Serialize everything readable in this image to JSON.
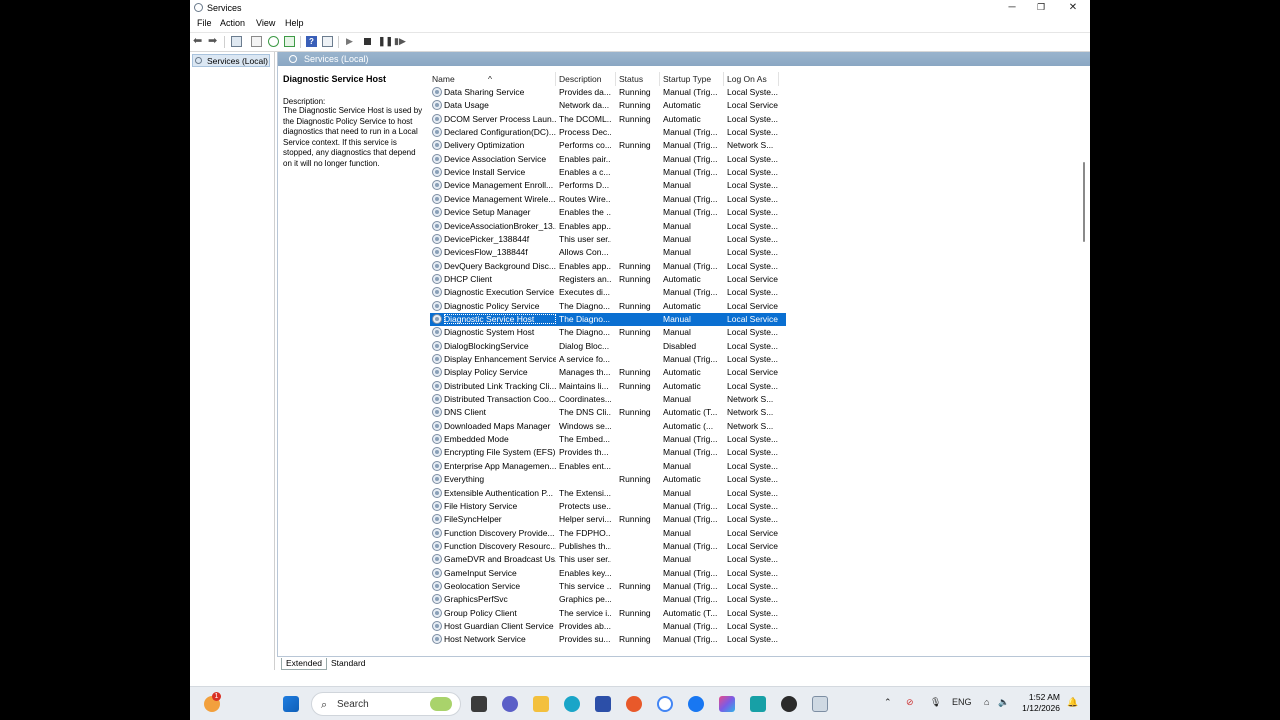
{
  "window": {
    "title": "Services",
    "minimize": "─",
    "maximize": "❐",
    "close": "✕"
  },
  "menu": [
    "File",
    "Action",
    "View",
    "Help"
  ],
  "tree": {
    "item": "Services (Local)"
  },
  "pane": {
    "header": "Services (Local)"
  },
  "details": {
    "service_title": "Diagnostic Service Host",
    "description_label": "Description:",
    "description": "The Diagnostic Service Host is used by the Diagnostic Policy Service to host diagnostics that need to run in a Local Service context.  If this service is stopped, any diagnostics that depend on it will no longer function."
  },
  "columns": [
    "Name",
    "Description",
    "Status",
    "Startup Type",
    "Log On As"
  ],
  "services": [
    [
      "Data Sharing Service",
      "Provides da...",
      "Running",
      "Manual (Trig...",
      "Local Syste..."
    ],
    [
      "Data Usage",
      "Network da...",
      "Running",
      "Automatic",
      "Local Service"
    ],
    [
      "DCOM Server Process Laun...",
      "The DCOML...",
      "Running",
      "Automatic",
      "Local Syste..."
    ],
    [
      "Declared Configuration(DC)...",
      "Process Dec...",
      "",
      "Manual (Trig...",
      "Local Syste..."
    ],
    [
      "Delivery Optimization",
      "Performs co...",
      "Running",
      "Manual (Trig...",
      "Network S..."
    ],
    [
      "Device Association Service",
      "Enables pair...",
      "",
      "Manual (Trig...",
      "Local Syste..."
    ],
    [
      "Device Install Service",
      "Enables a c...",
      "",
      "Manual (Trig...",
      "Local Syste..."
    ],
    [
      "Device Management Enroll...",
      "Performs D...",
      "",
      "Manual",
      "Local Syste..."
    ],
    [
      "Device Management Wirele...",
      "Routes Wire...",
      "",
      "Manual (Trig...",
      "Local Syste..."
    ],
    [
      "Device Setup Manager",
      "Enables the ...",
      "",
      "Manual (Trig...",
      "Local Syste..."
    ],
    [
      "DeviceAssociationBroker_13...",
      "Enables app...",
      "",
      "Manual",
      "Local Syste..."
    ],
    [
      "DevicePicker_138844f",
      "This user ser...",
      "",
      "Manual",
      "Local Syste..."
    ],
    [
      "DevicesFlow_138844f",
      "Allows Con...",
      "",
      "Manual",
      "Local Syste..."
    ],
    [
      "DevQuery Background Disc...",
      "Enables app...",
      "Running",
      "Manual (Trig...",
      "Local Syste..."
    ],
    [
      "DHCP Client",
      "Registers an...",
      "Running",
      "Automatic",
      "Local Service"
    ],
    [
      "Diagnostic Execution Service",
      "Executes di...",
      "",
      "Manual (Trig...",
      "Local Syste..."
    ],
    [
      "Diagnostic Policy Service",
      "The Diagno...",
      "Running",
      "Automatic",
      "Local Service"
    ],
    [
      "Diagnostic Service Host",
      "The Diagno...",
      "",
      "Manual",
      "Local Service"
    ],
    [
      "Diagnostic System Host",
      "The Diagno...",
      "Running",
      "Manual",
      "Local Syste..."
    ],
    [
      "DialogBlockingService",
      "Dialog Bloc...",
      "",
      "Disabled",
      "Local Syste..."
    ],
    [
      "Display Enhancement Service",
      "A service fo...",
      "",
      "Manual (Trig...",
      "Local Syste..."
    ],
    [
      "Display Policy Service",
      "Manages th...",
      "Running",
      "Automatic",
      "Local Service"
    ],
    [
      "Distributed Link Tracking Cli...",
      "Maintains li...",
      "Running",
      "Automatic",
      "Local Syste..."
    ],
    [
      "Distributed Transaction Coo...",
      "Coordinates...",
      "",
      "Manual",
      "Network S..."
    ],
    [
      "DNS Client",
      "The DNS Cli...",
      "Running",
      "Automatic (T...",
      "Network S..."
    ],
    [
      "Downloaded Maps Manager",
      "Windows se...",
      "",
      "Automatic (...",
      "Network S..."
    ],
    [
      "Embedded Mode",
      "The Embed...",
      "",
      "Manual (Trig...",
      "Local Syste..."
    ],
    [
      "Encrypting File System (EFS)",
      "Provides th...",
      "",
      "Manual (Trig...",
      "Local Syste..."
    ],
    [
      "Enterprise App Managemen...",
      "Enables ent...",
      "",
      "Manual",
      "Local Syste..."
    ],
    [
      "Everything",
      "",
      "Running",
      "Automatic",
      "Local Syste..."
    ],
    [
      "Extensible Authentication P...",
      "The Extensi...",
      "",
      "Manual",
      "Local Syste..."
    ],
    [
      "File History Service",
      "Protects use...",
      "",
      "Manual (Trig...",
      "Local Syste..."
    ],
    [
      "FileSyncHelper",
      "Helper servi...",
      "Running",
      "Manual (Trig...",
      "Local Syste..."
    ],
    [
      "Function Discovery Provide...",
      "The FDPHO...",
      "",
      "Manual",
      "Local Service"
    ],
    [
      "Function Discovery Resourc...",
      "Publishes th...",
      "",
      "Manual (Trig...",
      "Local Service"
    ],
    [
      "GameDVR and Broadcast Us...",
      "This user ser...",
      "",
      "Manual",
      "Local Syste..."
    ],
    [
      "GameInput Service",
      "Enables key...",
      "",
      "Manual (Trig...",
      "Local Syste..."
    ],
    [
      "Geolocation Service",
      "This service ...",
      "Running",
      "Manual (Trig...",
      "Local Syste..."
    ],
    [
      "GraphicsPerfSvc",
      "Graphics pe...",
      "",
      "Manual (Trig...",
      "Local Syste..."
    ],
    [
      "Group Policy Client",
      "The service i...",
      "Running",
      "Automatic (T...",
      "Local Syste..."
    ],
    [
      "Host Guardian Client Service",
      "Provides ab...",
      "",
      "Manual (Trig...",
      "Local Syste..."
    ],
    [
      "Host Network Service",
      "Provides su...",
      "Running",
      "Manual (Trig...",
      "Local Syste..."
    ]
  ],
  "selected_service": "Diagnostic Service Host",
  "tabs": [
    "Extended",
    "Standard"
  ],
  "taskbar": {
    "search_placeholder": "Search",
    "notification_badge": "1",
    "language": "ENG",
    "time": "1:52 AM",
    "date": "1/12/2026"
  },
  "colors": {
    "selection": "#0a6fd1",
    "pane_header": "#8aa7c3",
    "taskbar": "#e9edf2"
  }
}
